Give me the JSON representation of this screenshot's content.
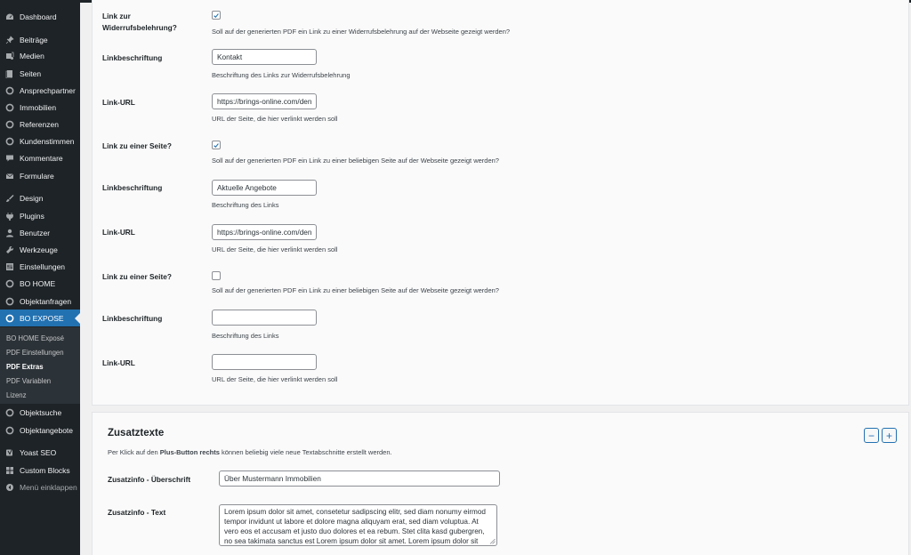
{
  "sidebar": {
    "items": [
      {
        "label": "Dashboard",
        "icon": "dashboard-icon"
      },
      {
        "label": "Beiträge",
        "icon": "pin-icon"
      },
      {
        "label": "Medien",
        "icon": "media-icon"
      },
      {
        "label": "Seiten",
        "icon": "pages-icon"
      },
      {
        "label": "Ansprechpartner",
        "icon": "circle-icon"
      },
      {
        "label": "Immobilien",
        "icon": "circle-icon"
      },
      {
        "label": "Referenzen",
        "icon": "circle-icon"
      },
      {
        "label": "Kundenstimmen",
        "icon": "circle-icon"
      },
      {
        "label": "Kommentare",
        "icon": "comment-icon"
      },
      {
        "label": "Formulare",
        "icon": "mail-icon"
      },
      {
        "label": "Design",
        "icon": "brush-icon"
      },
      {
        "label": "Plugins",
        "icon": "plugin-icon"
      },
      {
        "label": "Benutzer",
        "icon": "user-icon"
      },
      {
        "label": "Werkzeuge",
        "icon": "wrench-icon"
      },
      {
        "label": "Einstellungen",
        "icon": "settings-icon"
      },
      {
        "label": "BO HOME",
        "icon": "circle-icon"
      },
      {
        "label": "Objektanfragen",
        "icon": "circle-icon"
      },
      {
        "label": "BO EXPOSE",
        "icon": "circle-icon"
      },
      {
        "label": "Objektsuche",
        "icon": "circle-icon"
      },
      {
        "label": "Objektangebote",
        "icon": "circle-icon"
      },
      {
        "label": "Yoast SEO",
        "icon": "yoast-icon"
      },
      {
        "label": "Custom Blocks",
        "icon": "blocks-icon"
      },
      {
        "label": "Menü einklappen",
        "icon": "collapse-icon"
      }
    ],
    "submenu": [
      "BO HOME Exposé",
      "PDF Einstellungen",
      "PDF Extras",
      "PDF Variablen",
      "Lizenz"
    ],
    "active_color": "#2271b1"
  },
  "pdf": {
    "link_widerruf_label": "Link zur Widerrufsbelehrung?",
    "link_widerruf_desc": "Soll auf der generierten PDF ein Link zu einer Widerrufsbelehrung auf der Webseite gezeigt werden?",
    "rows": [
      {
        "beschriftung_label": "Linkbeschriftung",
        "beschriftung_value": "Kontakt",
        "beschriftung_desc": "Beschriftung des Links zur Widerrufsbelehrung",
        "url_label": "Link-URL",
        "url_value": "https://brings-online.com/den",
        "url_desc": "URL der Seite, die hier verlinkt werden soll"
      },
      {
        "check_label": "Link zu einer Seite?",
        "check_desc": "Soll auf der generierten PDF ein Link zu einer beliebigen Seite auf der Webseite gezeigt werden?",
        "beschriftung_label": "Linkbeschriftung",
        "beschriftung_value": "Aktuelle Angebote",
        "beschriftung_desc": "Beschriftung des Links",
        "url_label": "Link-URL",
        "url_value": "https://brings-online.com/den",
        "url_desc": "URL der Seite, die hier verlinkt werden soll"
      },
      {
        "check_label": "Link zu einer Seite?",
        "check_desc": "Soll auf der generierten PDF ein Link zu einer beliebigen Seite auf der Webseite gezeigt werden?",
        "beschriftung_label": "Linkbeschriftung",
        "beschriftung_value": "",
        "beschriftung_desc": "Beschriftung des Links",
        "url_label": "Link-URL",
        "url_value": "",
        "url_desc": "URL der Seite, die hier verlinkt werden soll"
      }
    ]
  },
  "zusatz": {
    "title": "Zusatztexte",
    "desc_pre": "Per Klick auf den ",
    "desc_bold": "Plus-Button rechts",
    "desc_post": " können beliebig viele neue Textabschnitte erstellt werden.",
    "minus": "−",
    "plus": "+",
    "heading_label": "Zusatzinfo - Überschrift",
    "heading_value": "Über Mustermann Immobilien",
    "text_label": "Zusatzinfo - Text",
    "text_value": "Lorem ipsum dolor sit amet, consetetur sadipscing elitr, sed diam nonumy eirmod tempor invidunt ut labore et dolore magna aliquyam erat, sed diam voluptua. At vero eos et accusam et justo duo dolores et ea rebum. Stet clita kasd gubergren, no sea takimata sanctus est Lorem ipsum dolor sit amet. Lorem ipsum dolor sit amet,"
  }
}
